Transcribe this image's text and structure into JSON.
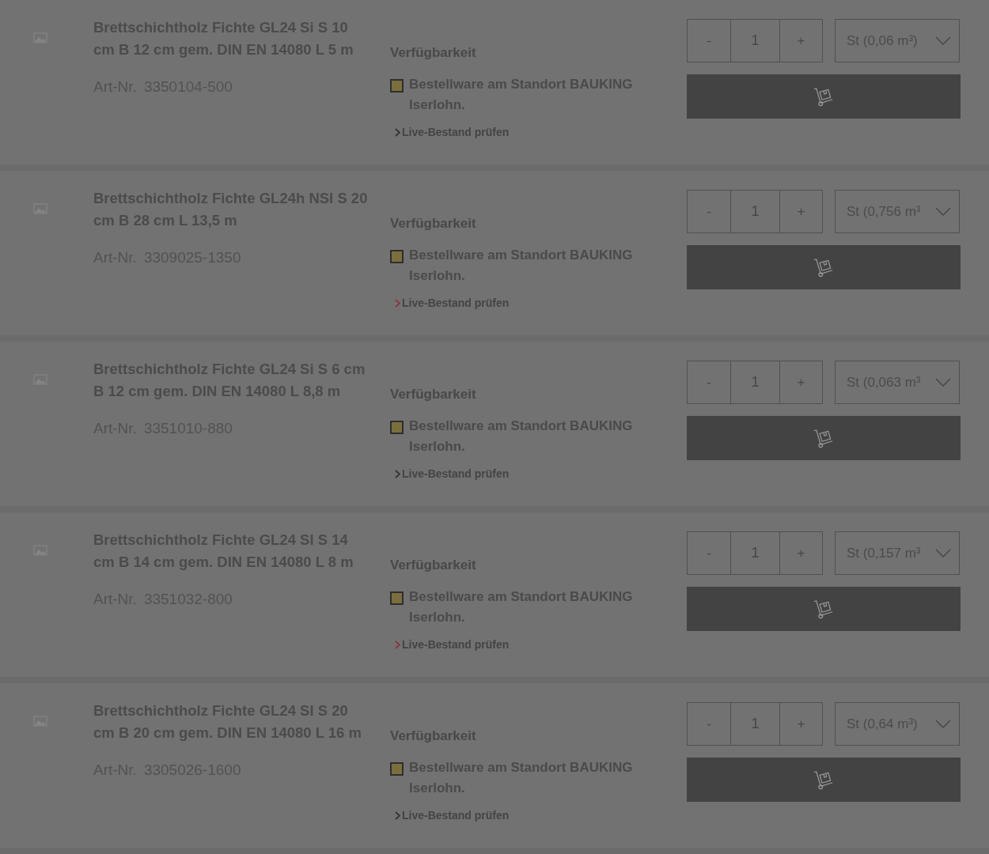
{
  "products": [
    {
      "title": "Brettschichtholz Fichte GL24 Si S 10 cm B 12 cm gem. DIN EN 14080 L 5 m",
      "article_label": "Art-Nr.",
      "article_number": "3350104-500",
      "availability_heading": "Verfügbarkeit",
      "availability_status": "Bestellware am Standort BAUKING Iserlohn.",
      "stock_link": {
        "label": "Live-Bestand prüfen",
        "color": "#333333"
      },
      "quantity": {
        "decrement": "-",
        "value": "1",
        "increment": "+"
      },
      "unit": "St (0,06 m³)"
    },
    {
      "title": "Brettschichtholz Fichte GL24h NSI S 20 cm B 28 cm L 13,5 m",
      "article_label": "Art-Nr.",
      "article_number": "3309025-1350",
      "availability_heading": "Verfügbarkeit",
      "availability_status": "Bestellware am Standort BAUKING Iserlohn.",
      "stock_link": {
        "label": "Live-Bestand prüfen",
        "color": "#8a3440"
      },
      "quantity": {
        "decrement": "-",
        "value": "1",
        "increment": "+"
      },
      "unit": "St (0,756 m³"
    },
    {
      "title": "Brettschichtholz Fichte GL24 Si S 6 cm B 12 cm gem. DIN EN 14080 L 8,8 m",
      "article_label": "Art-Nr.",
      "article_number": "3351010-880",
      "availability_heading": "Verfügbarkeit",
      "availability_status": "Bestellware am Standort BAUKING Iserlohn.",
      "stock_link": {
        "label": "Live-Bestand prüfen",
        "color": "#333333"
      },
      "quantity": {
        "decrement": "-",
        "value": "1",
        "increment": "+"
      },
      "unit": "St (0,063 m³"
    },
    {
      "title": "Brettschichtholz Fichte GL24 SI S 14 cm B 14 cm gem. DIN EN 14080 L 8 m",
      "article_label": "Art-Nr.",
      "article_number": "3351032-800",
      "availability_heading": "Verfügbarkeit",
      "availability_status": "Bestellware am Standort BAUKING Iserlohn.",
      "stock_link": {
        "label": "Live-Bestand prüfen",
        "color": "#8a3440"
      },
      "quantity": {
        "decrement": "-",
        "value": "1",
        "increment": "+"
      },
      "unit": "St (0,157 m³"
    },
    {
      "title": "Brettschichtholz Fichte GL24 SI S 20 cm B 20 cm gem. DIN EN 14080 L 16 m",
      "article_label": "Art-Nr.",
      "article_number": "3305026-1600",
      "availability_heading": "Verfügbarkeit",
      "availability_status": "Bestellware am Standort BAUKING Iserlohn.",
      "stock_link": {
        "label": "Live-Bestand prüfen",
        "color": "#333333"
      },
      "quantity": {
        "decrement": "-",
        "value": "1",
        "increment": "+"
      },
      "unit": "St (0,64 m³)"
    }
  ]
}
